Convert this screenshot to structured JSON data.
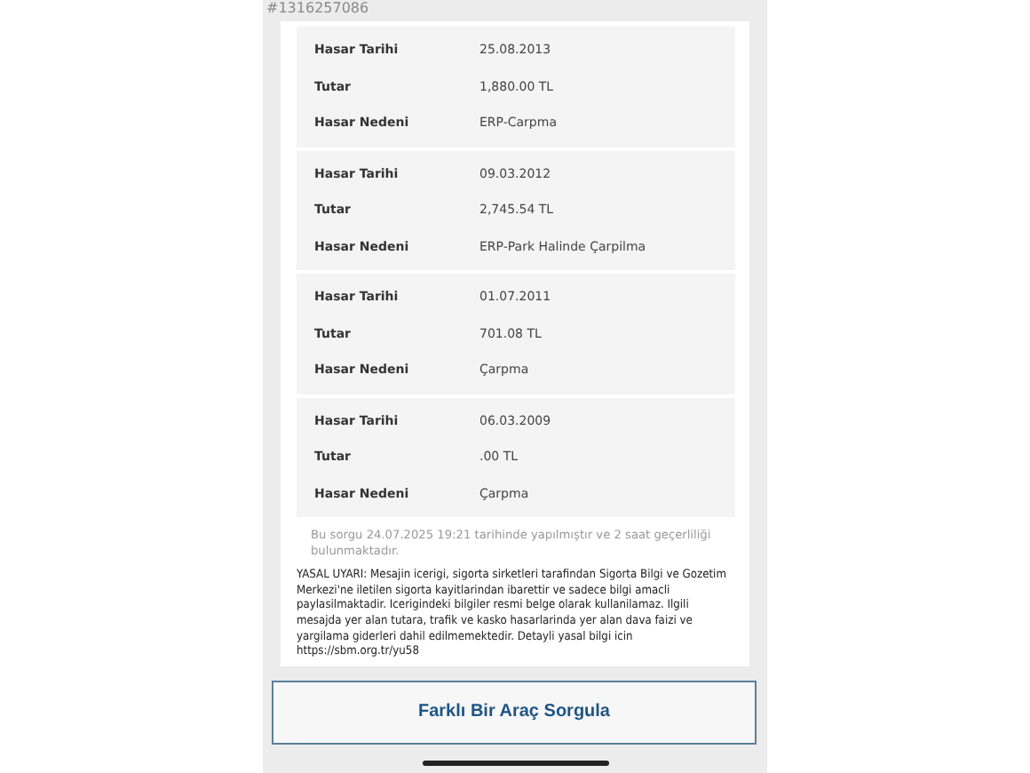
{
  "query_id": "#1316257086",
  "claims": [
    {
      "fields": [
        {
          "label": "Hasar Tarihi",
          "value": "25.08.2013"
        },
        {
          "label": "Tutar",
          "value": "1,880.00 TL"
        },
        {
          "label": "Hasar Nedeni",
          "value": "ERP-Carpma"
        }
      ]
    },
    {
      "fields": [
        {
          "label": "Hasar Tarihi",
          "value": "09.03.2012"
        },
        {
          "label": "Tutar",
          "value": "2,745.54 TL"
        },
        {
          "label": "Hasar Nedeni",
          "value": "ERP-Park Halinde Çarpilma"
        }
      ]
    },
    {
      "fields": [
        {
          "label": "Hasar Tarihi",
          "value": "01.07.2011"
        },
        {
          "label": "Tutar",
          "value": "701.08 TL"
        },
        {
          "label": "Hasar Nedeni",
          "value": "Çarpma"
        }
      ]
    },
    {
      "fields": [
        {
          "label": "Hasar Tarihi",
          "value": "06.03.2009"
        },
        {
          "label": "Tutar",
          "value": ".00 TL"
        },
        {
          "label": "Hasar Nedeni",
          "value": "Çarpma"
        }
      ]
    }
  ],
  "query_note": "Bu sorgu 24.07.2025 19:21 tarihinde yapılmıştır ve 2 saat geçerliliği bulunmaktadır.",
  "legal_warning": "YASAL UYARI: Mesajin icerigi, sigorta sirketleri tarafindan Sigorta Bilgi ve Gozetim Merkezi'ne iletilen sigorta kayitlarindan ibarettir ve sadece bilgi amacli paylasilmaktadir. Icerigindeki bilgiler resmi belge olarak kullanilamaz. Ilgili mesajda yer alan tutara, trafik ve kasko hasarlarinda yer alan dava faizi ve yargilama giderleri dahil edilmemektedir. Detayli yasal bilgi icin https://sbm.org.tr/yu58",
  "button": "Farklı Bir Araç Sorgula"
}
